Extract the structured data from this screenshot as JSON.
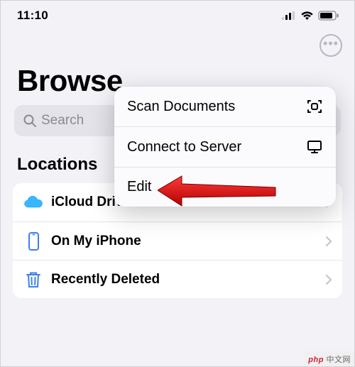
{
  "status": {
    "time": "11:10"
  },
  "page": {
    "title": "Browse"
  },
  "search": {
    "placeholder": "Search"
  },
  "menu": {
    "scan": "Scan Documents",
    "connect": "Connect to Server",
    "edit": "Edit"
  },
  "sections": {
    "locations": "Locations"
  },
  "locations": {
    "0": {
      "label": "iCloud Drive"
    },
    "1": {
      "label": "On My iPhone"
    },
    "2": {
      "label": "Recently Deleted"
    }
  },
  "watermark": {
    "brand": "php",
    "text": " 中文网"
  }
}
